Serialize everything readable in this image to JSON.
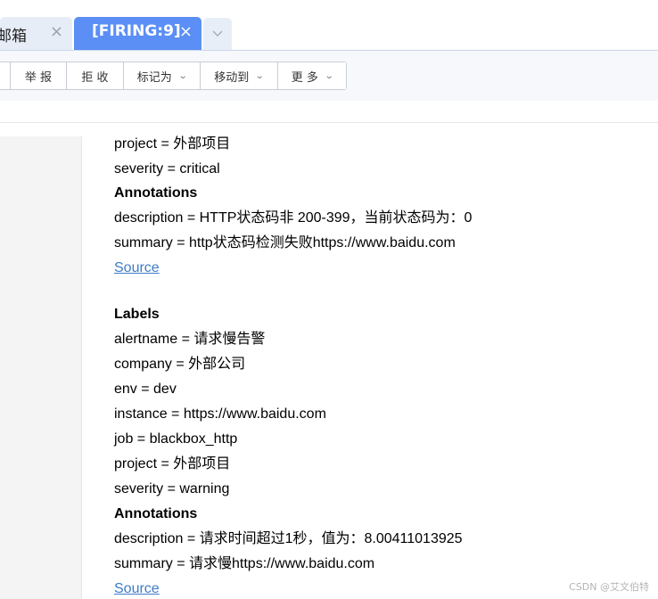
{
  "tabs": [
    {
      "label": "邮箱",
      "close": "×"
    },
    {
      "label": "[FIRING:9]",
      "close": "×"
    }
  ],
  "tab_more_icon": "chevron-down-icon",
  "toolbar": {
    "report_label": "举 报",
    "reject_label": "拒 收",
    "mark_as_label": "标记为",
    "move_to_label": "移动到",
    "more_label": "更 多",
    "chevron": "⌄"
  },
  "alert1": {
    "project": "project = 外部项目",
    "severity": "severity = critical",
    "annotations_heading": "Annotations",
    "description": "description = HTTP状态码非 200-399，当前状态码为：0",
    "summary": "summary = http状态码检测失败https://www.baidu.com",
    "source_link": "Source"
  },
  "alert2": {
    "labels_heading": "Labels",
    "alertname": "alertname = 请求慢告警",
    "company": "company = 外部公司",
    "env": "env = dev",
    "instance": "instance = https://www.baidu.com",
    "job": "job = blackbox_http",
    "project": "project = 外部项目",
    "severity": "severity = warning",
    "annotations_heading": "Annotations",
    "description": "description = 请求时间超过1秒，值为：8.00411013925",
    "summary": "summary = 请求慢https://www.baidu.com",
    "source_link": "Source"
  },
  "watermark": "CSDN @艾文伯特",
  "colors": {
    "active_tab": "#5b8ff5",
    "link": "#3e7cc6"
  }
}
